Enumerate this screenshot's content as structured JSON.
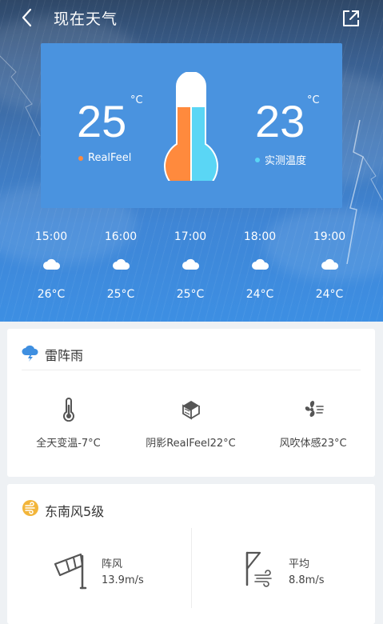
{
  "header": {
    "title": "现在天气",
    "back_icon": "back-icon",
    "share_icon": "share-icon"
  },
  "current": {
    "realfeel_temp": "25",
    "realfeel_unit": "°C",
    "realfeel_label": "RealFeel",
    "realfeel_color": "#ff8a3d",
    "measured_temp": "23",
    "measured_unit": "°C",
    "measured_label": "实测温度",
    "measured_color": "#5ad6f5",
    "thermometer_icon": "thermometer-icon"
  },
  "hourly": [
    {
      "time": "15:00",
      "temp": "26°C",
      "icon": "cloud-icon"
    },
    {
      "time": "16:00",
      "temp": "25°C",
      "icon": "cloud-icon"
    },
    {
      "time": "17:00",
      "temp": "25°C",
      "icon": "cloud-icon"
    },
    {
      "time": "18:00",
      "temp": "24°C",
      "icon": "cloud-icon"
    },
    {
      "time": "19:00",
      "temp": "24°C",
      "icon": "cloud-icon"
    }
  ],
  "condition": {
    "title": "雷阵雨",
    "icon": "thunderstorm-icon",
    "stats": [
      {
        "label": "全天变温-7°C",
        "icon": "thermometer-icon"
      },
      {
        "label": "阴影RealFeel22°C",
        "icon": "shade-icon"
      },
      {
        "label": "风吹体感23°C",
        "icon": "fan-icon"
      }
    ]
  },
  "wind": {
    "title": "东南风5级",
    "icon": "wind-icon",
    "gust": {
      "label": "阵风",
      "value": "13.9m/s",
      "icon": "windsock-icon"
    },
    "average": {
      "label": "平均",
      "value": "8.8m/s",
      "icon": "wind-flag-icon"
    }
  },
  "colors": {
    "accent": "#3f8fe0",
    "card_bg": "#4a93df",
    "wind_badge": "#f2b53a"
  }
}
